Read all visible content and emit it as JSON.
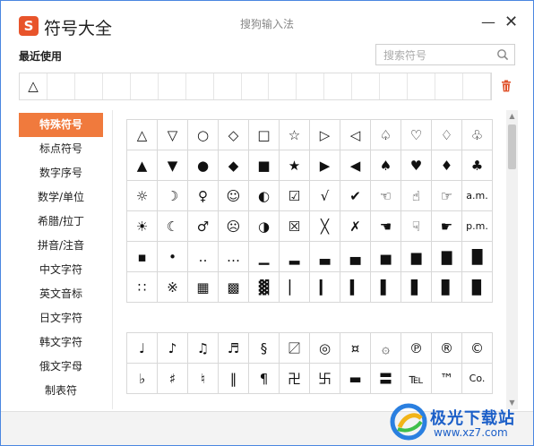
{
  "app": {
    "logo_text": "S",
    "title": "符号大全",
    "window_title": "搜狗输入法",
    "minimize": "—",
    "close": "✕"
  },
  "recent": {
    "label": "最近使用",
    "cells": [
      "△",
      "",
      "",
      "",
      "",
      "",
      "",
      "",
      "",
      "",
      "",
      "",
      "",
      "",
      "",
      "",
      ""
    ]
  },
  "search": {
    "placeholder": "搜索符号",
    "value": ""
  },
  "sidebar": {
    "items": [
      {
        "label": "特殊符号"
      },
      {
        "label": "标点符号"
      },
      {
        "label": "数字序号"
      },
      {
        "label": "数学/单位"
      },
      {
        "label": "希腊/拉丁"
      },
      {
        "label": "拼音/注音"
      },
      {
        "label": "中文字符"
      },
      {
        "label": "英文音标"
      },
      {
        "label": "日文字符"
      },
      {
        "label": "韩文字符"
      },
      {
        "label": "俄文字母"
      },
      {
        "label": "制表符"
      }
    ]
  },
  "grid1": [
    [
      "△",
      "▽",
      "○",
      "◇",
      "□",
      "☆",
      "▷",
      "◁",
      "♤",
      "♡",
      "♢",
      "♧"
    ],
    [
      "▲",
      "▼",
      "●",
      "◆",
      "■",
      "★",
      "▶",
      "◀",
      "♠",
      "♥",
      "♦",
      "♣"
    ],
    [
      "☼",
      "☽",
      "♀",
      "☺",
      "◐",
      "☑",
      "√",
      "✔",
      "☜",
      "☝",
      "☞",
      "a.m."
    ],
    [
      "☀",
      "☾",
      "♂",
      "☹",
      "◑",
      "☒",
      "╳",
      "✗",
      "☚",
      "☟",
      "☛",
      "p.m."
    ],
    [
      "▪",
      "•",
      "‥",
      "…",
      "▁",
      "▂",
      "▃",
      "▄",
      "▅",
      "▆",
      "▇",
      "█"
    ],
    [
      "∷",
      "※",
      "▦",
      "▩",
      "▓",
      "▏",
      "▎",
      "▍",
      "▌",
      "▋",
      "▊",
      "▉"
    ]
  ],
  "grid2": [
    [
      "♩",
      "♪",
      "♫",
      "♬",
      "§",
      "〼",
      "◎",
      "¤",
      "۞",
      "℗",
      "®",
      "©"
    ],
    [
      "♭",
      "♯",
      "♮",
      "‖",
      "¶",
      "卍",
      "卐",
      "▬",
      "〓",
      "℡",
      "™",
      "Co."
    ]
  ],
  "watermark": {
    "name": "极光下载站",
    "url": "www.xz7.com"
  },
  "colors": {
    "accent": "#f07a3d",
    "logo": "#e8542b",
    "window_border": "#4a86e0",
    "trash": "#e0542d"
  }
}
